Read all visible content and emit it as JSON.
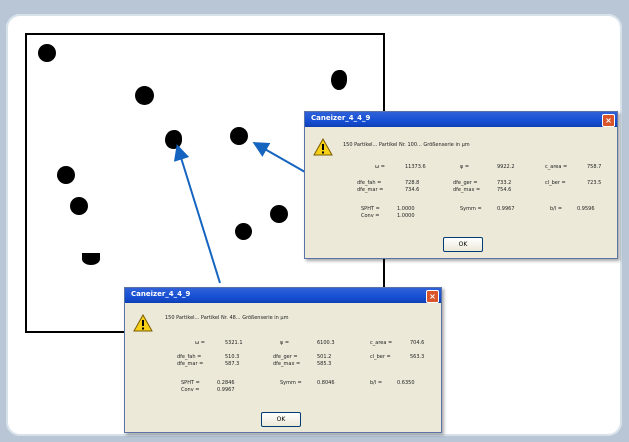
{
  "dialog_top": {
    "title": "Caneizer_4_4_9",
    "close": "×",
    "header": "150 Partikel... Partikel Nr. 100... Größenserie in µm",
    "row1": {
      "l1": "ω =",
      "v1": "11373.6",
      "l2": "ψ =",
      "v2": "9922.2",
      "l3": "c_area =",
      "v3": "758.7"
    },
    "row2": {
      "l1": "dfe_fah =",
      "v1": "728.8",
      "l2": "dfe_ger =",
      "v2": "733.2",
      "l3": "cl_ber =",
      "v3": "723.5"
    },
    "row3": {
      "l1": "dfe_mar =",
      "v1": "734.6",
      "l2": "dfe_max =",
      "v2": "754.6"
    },
    "row4": {
      "l1": "SPHT =",
      "v1": "1.0000",
      "l2": "Symm =",
      "v2": "0.9967",
      "l3": "b/l =",
      "v3": "0.9596"
    },
    "row5": {
      "l1": "Conv =",
      "v1": "1.0000"
    },
    "ok": "OK"
  },
  "dialog_bottom": {
    "title": "Caneizer_4_4_9",
    "close": "×",
    "header": "150 Partikel... Partikel Nr. 48... Größenserie in µm",
    "row1": {
      "l1": "ω =",
      "v1": "5321.1",
      "l2": "ψ =",
      "v2": "6100.3",
      "l3": "c_area =",
      "v3": "704.6"
    },
    "row2": {
      "l1": "dfe_fah =",
      "v1": "510.3",
      "l2": "dfe_ger =",
      "v2": "501.2",
      "l3": "cl_ber =",
      "v3": "563.3"
    },
    "row3": {
      "l1": "dfe_mar =",
      "v1": "587.3",
      "l2": "dfe_max =",
      "v2": "585.3"
    },
    "row4": {
      "l1": "SPHT =",
      "v1": "0.2846",
      "l2": "Symm =",
      "v2": "0.8046",
      "l3": "b/l =",
      "v3": "0.6350"
    },
    "row5": {
      "l1": "Conv =",
      "v1": "0.9967"
    },
    "ok": "OK"
  },
  "colors": {
    "arrow": "#1565c0",
    "titlebar": "#164fd3",
    "dialog_bg": "#ece9d8"
  },
  "icons": [
    "warning-icon",
    "close-icon"
  ]
}
